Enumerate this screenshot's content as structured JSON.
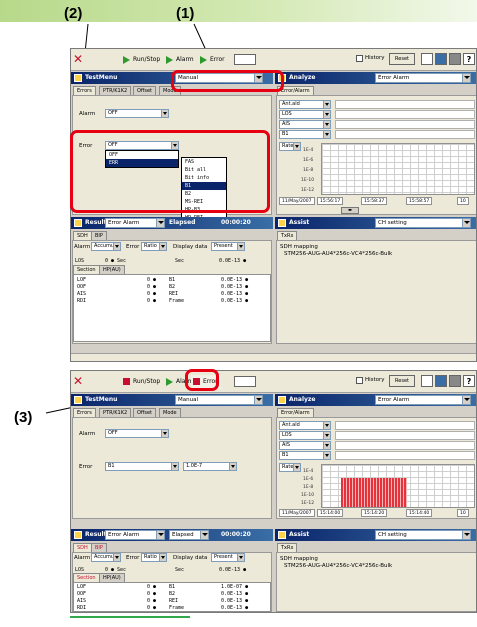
{
  "callouts": {
    "c1": "(1)",
    "c2": "(2)",
    "c3": "(3)"
  },
  "toolbar": {
    "runstop": "Run/Stop",
    "alarm": "Alarm",
    "error": "Error",
    "history": "History",
    "reset": "Reset"
  },
  "left_panel": {
    "title": "TestMenu",
    "mode_top": "Manual",
    "mode_bottom": "Manual",
    "tabs": [
      "Errors",
      "PTR/K1K2",
      "Offset",
      "Mode"
    ],
    "alarm_label": "Alarm",
    "alarm_value": "OFF",
    "error_label": "Error",
    "error_value_top": "OFF",
    "error_value_bottom": "B1",
    "rate_value": "1.0E-7",
    "dropdown_options": [
      "OFF",
      "ERR"
    ],
    "error_list": [
      "FAS",
      "Bit all",
      "Bit info",
      "B1",
      "B2",
      "MS-REI",
      "HP-B3",
      "HP-REI"
    ]
  },
  "analyze_panel": {
    "title": "Analyze",
    "mode": "Error Alarm",
    "tab": "Error/Alarm",
    "rows": [
      "Ant.ald",
      "LOS",
      "AIS",
      "B1"
    ],
    "rate_label": "Rate",
    "y_ticks": [
      "1E-4",
      "1E-6",
      "1E-8",
      "1E-10",
      "1E-12"
    ],
    "x_date": "11/May/2007",
    "x_times_top": [
      "15:56:17",
      "15:58:37",
      "15:58:57"
    ],
    "x_times_bottom": [
      "15:14:00",
      "15:14:20",
      "15:14:40"
    ],
    "x_right": "10"
  },
  "result_panel": {
    "title": "Result",
    "mode": "Error Alarm",
    "elapsed_label": "Elapsed",
    "elapsed_value_top": "00:00:20",
    "elapsed_value_bottom": "00:00:20",
    "tabs": [
      "SDH",
      "BIP"
    ],
    "alarm_label": "Alarm",
    "alarm_value": "Accumul",
    "error_label": "Error",
    "error_value": "Ratio",
    "display_label": "Display data",
    "display_value": "Present",
    "los_row": "LOS",
    "los_right": "Sec",
    "error_col": "0 ● Sec",
    "sub_tabs": [
      "Section",
      "HP(AU)"
    ],
    "alarms": [
      "LOF",
      "OOF",
      "AIS",
      "RDI"
    ],
    "counts": [
      "0 ●",
      "0 ●",
      "0 ●",
      "0 ●"
    ],
    "errors": [
      "B1",
      "B2",
      "REI",
      "Frame"
    ],
    "values_top": [
      "0.0E-13 ●",
      "0.0E-13 ●",
      "0.0E-13 ●",
      "0.0E-13 ●"
    ],
    "values_bottom": [
      "1.0E-07 ●",
      "0.0E-13 ●",
      "0.0E-13 ●",
      "0.0E-13 ●"
    ],
    "los_values": [
      "0.0E-13 ●",
      "0.0E-13 ●"
    ]
  },
  "assist_panel": {
    "title": "Assist",
    "mode": "CH setting",
    "tab": "TxRx",
    "mapping_label": "SDH mapping",
    "mapping_value": "STM256-AUG-AU4*256c-VC4*256c-Bulk"
  }
}
